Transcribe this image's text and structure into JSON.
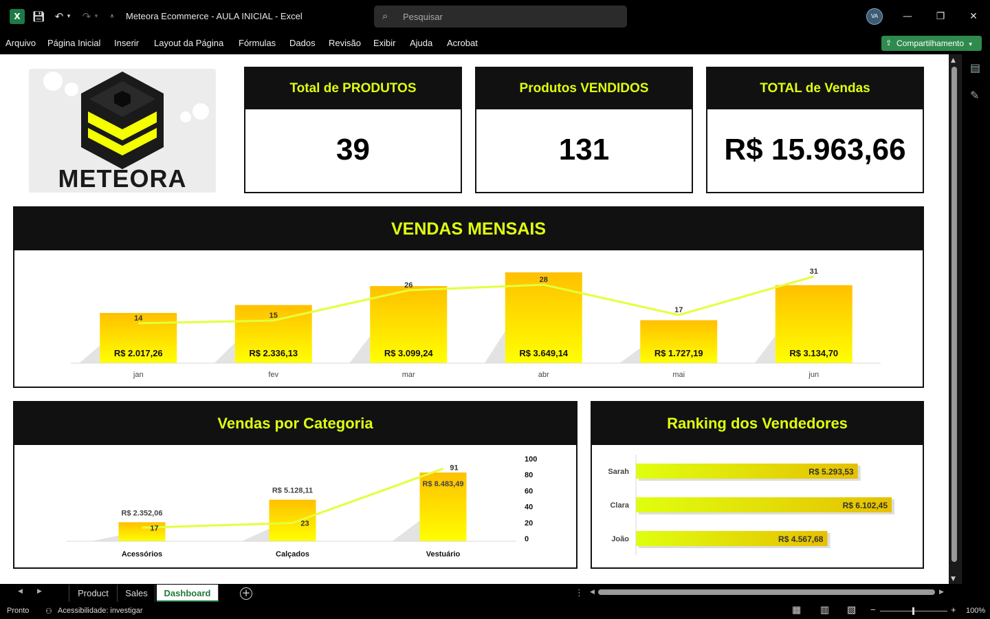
{
  "window": {
    "title": "Meteora Ecommerce - AULA INICIAL  -  Excel",
    "search_placeholder": "Pesquisar",
    "avatar": "VA"
  },
  "ribbon": {
    "tabs": [
      "Arquivo",
      "Página Inicial",
      "Inserir",
      "Layout da Página",
      "Fórmulas",
      "Dados",
      "Revisão",
      "Exibir",
      "Ajuda",
      "Acrobat"
    ],
    "share_label": "Compartilhamento"
  },
  "logo": {
    "text": "METEORA"
  },
  "kpis": [
    {
      "label": "Total de PRODUTOS",
      "value": "39"
    },
    {
      "label": "Produtos VENDIDOS",
      "value": "131"
    },
    {
      "label": "TOTAL de Vendas",
      "value": "R$ 15.963,66"
    }
  ],
  "colors": {
    "accent": "#dfff0f",
    "bar_top": "#ffc000",
    "bar_bottom": "#ffff00",
    "panel_head": "#111111",
    "tab_green": "#1e7a3a"
  },
  "chart_data": [
    {
      "type": "bar",
      "title": "VENDAS MENSAIS",
      "categories": [
        "jan",
        "fev",
        "mar",
        "abr",
        "mai",
        "jun"
      ],
      "series": [
        {
          "values": [
            2017.26,
            2336.13,
            3099.24,
            3649.14,
            1727.19,
            3134.7
          ],
          "labels": [
            "R$ 2.017,26",
            "R$ 2.336,13",
            "R$ 3.099,24",
            "R$ 3.649,14",
            "R$ 1.727,19",
            "R$ 3.134,70"
          ]
        },
        {
          "values": [
            14,
            15,
            26,
            28,
            17,
            31
          ],
          "labels": [
            "14",
            "15",
            "26",
            "28",
            "17",
            "31"
          ],
          "type": "line"
        }
      ],
      "grid": false
    },
    {
      "type": "bar",
      "title": "Vendas por Categoria",
      "categories": [
        "Acessórios",
        "Calçados",
        "Vestuário"
      ],
      "series": [
        {
          "values": [
            2352.06,
            5128.11,
            8483.49
          ],
          "labels": [
            "R$ 2.352,06",
            "R$ 5.128,11",
            "R$ 8.483,49"
          ]
        },
        {
          "values": [
            17,
            23,
            91
          ],
          "labels": [
            "17",
            "23",
            "91"
          ],
          "type": "line"
        }
      ],
      "y2_ticks": [
        "100",
        "80",
        "60",
        "40",
        "20",
        "0"
      ],
      "y2lim": [
        0,
        100
      ],
      "grid": false
    },
    {
      "type": "bar",
      "orientation": "horizontal",
      "title": "Ranking dos Vendedores",
      "categories": [
        "Sarah",
        "Clara",
        "João"
      ],
      "values": [
        5293.53,
        6102.45,
        4567.68
      ],
      "labels": [
        "R$ 5.293,53",
        "R$ 6.102,45",
        "R$ 4.567,68"
      ],
      "grid": false
    }
  ],
  "sheets": {
    "tabs": [
      "Product",
      "Sales",
      "Dashboard"
    ],
    "active": "Dashboard"
  },
  "status": {
    "ready": "Pronto",
    "accessibility": "Acessibilidade: investigar",
    "zoom": "100%"
  }
}
